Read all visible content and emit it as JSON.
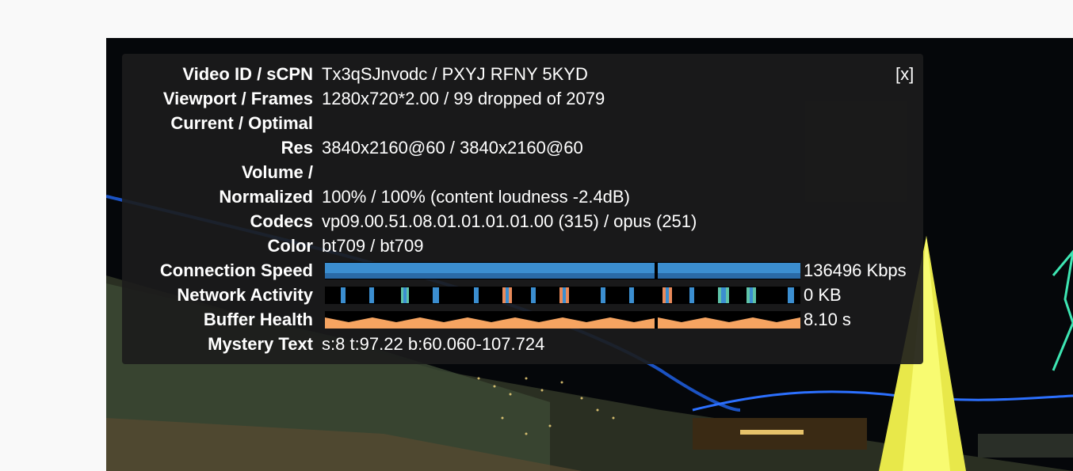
{
  "stats": {
    "close_label": "[x]",
    "rows": [
      {
        "label": "Video ID / sCPN",
        "value": "Tx3qSJnvodc / PXYJ RFNY 5KYD"
      },
      {
        "label": "Viewport / Frames",
        "value": "1280x720*2.00 / 99 dropped of 2079"
      },
      {
        "label": "Current / Optimal",
        "value": ""
      },
      {
        "label": "Res",
        "value": "3840x2160@60 / 3840x2160@60"
      },
      {
        "label": "Volume /",
        "value": ""
      },
      {
        "label": "Normalized",
        "value": "100% / 100% (content loudness -2.4dB)"
      },
      {
        "label": "Codecs",
        "value": "vp09.00.51.08.01.01.01.01.00 (315) / opus (251)"
      },
      {
        "label": "Color",
        "value": "bt709 / bt709"
      }
    ],
    "graphs": [
      {
        "label": "Connection Speed",
        "value": "136496 Kbps",
        "color": "#3b8ed0"
      },
      {
        "label": "Network Activity",
        "value": "0 KB",
        "color": "#3b8ed0"
      },
      {
        "label": "Buffer Health",
        "value": "8.10 s",
        "color": "#f6a461"
      }
    ],
    "mystery": {
      "label": "Mystery Text",
      "value": "s:8 t:97.22 b:60.060-107.724"
    }
  },
  "colors": {
    "overlay_bg": "#1c1c1c",
    "speed_bar": "#3b8ed0",
    "buffer_bar": "#f6a461",
    "network_bar": "#3b8ed0"
  }
}
